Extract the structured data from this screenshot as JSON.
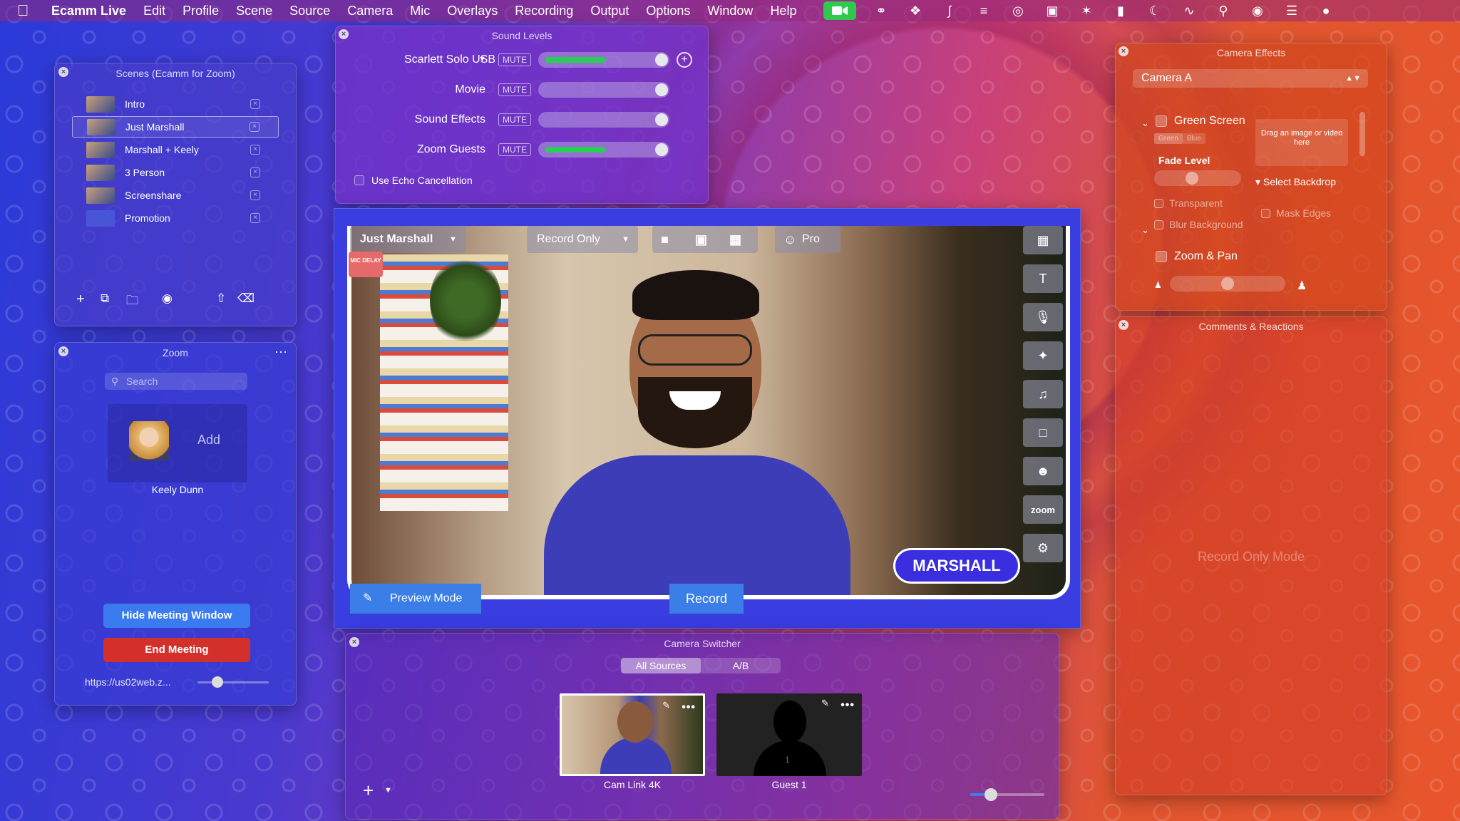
{
  "menubar": {
    "app": "Ecamm Live",
    "items": [
      "Edit",
      "Profile",
      "Scene",
      "Source",
      "Camera",
      "Mic",
      "Overlays",
      "Recording",
      "Output",
      "Options",
      "Window",
      "Help"
    ]
  },
  "scenes": {
    "title": "Scenes (Ecamm for Zoom)",
    "items": [
      {
        "label": "Intro"
      },
      {
        "label": "Just Marshall",
        "selected": true
      },
      {
        "label": "Marshall + Keely"
      },
      {
        "label": "3 Person"
      },
      {
        "label": "Screenshare"
      },
      {
        "label": "Promotion"
      }
    ]
  },
  "zoom": {
    "title": "Zoom",
    "search_placeholder": "Search",
    "participant": "Keely Dunn",
    "add_label": "Add",
    "hide_btn": "Hide Meeting Window",
    "end_btn": "End Meeting",
    "url": "https://us02web.z...",
    "slider_level": 0.2
  },
  "sound": {
    "title": "Sound Levels",
    "mute_label": "MUTE",
    "rows": [
      {
        "label": "Scarlett Solo USB",
        "level": 0.6
      },
      {
        "label": "Movie",
        "level": 0
      },
      {
        "label": "Sound Effects",
        "level": 0
      },
      {
        "label": "Zoom Guests",
        "level": 0.6
      }
    ],
    "echo": "Use Echo Cancellation"
  },
  "preview": {
    "scene_dropdown": "Just Marshall",
    "mode_dropdown": "Record Only",
    "pro_label": "Pro",
    "mic_delay": "MIC DELAY",
    "name_tag": "MARSHALL",
    "zoom_tool": "zoom",
    "preview_mode": "Preview Mode",
    "record": "Record"
  },
  "switcher": {
    "title": "Camera Switcher",
    "tabs": [
      "All Sources",
      "A/B"
    ],
    "cameras": [
      {
        "label": "Cam Link 4K"
      },
      {
        "label": "Guest 1",
        "number": "1"
      }
    ],
    "slider_level": 0.2
  },
  "effects": {
    "title": "Camera Effects",
    "camera": "Camera A",
    "green_screen": "Green Screen",
    "green": "Green",
    "blue": "Blue",
    "drop_hint": "Drag an image or video here",
    "fade_level": "Fade Level",
    "select_backdrop": "Select Backdrop",
    "transparent": "Transparent",
    "mask_edges": "Mask Edges",
    "blur_background": "Blur Background",
    "zoom_pan": "Zoom & Pan"
  },
  "comments": {
    "title": "Comments & Reactions",
    "placeholder": "Record Only Mode"
  },
  "colors": {
    "accent": "#3b7ee8",
    "record_green": "#29cf55",
    "end_red": "#d3302c"
  }
}
